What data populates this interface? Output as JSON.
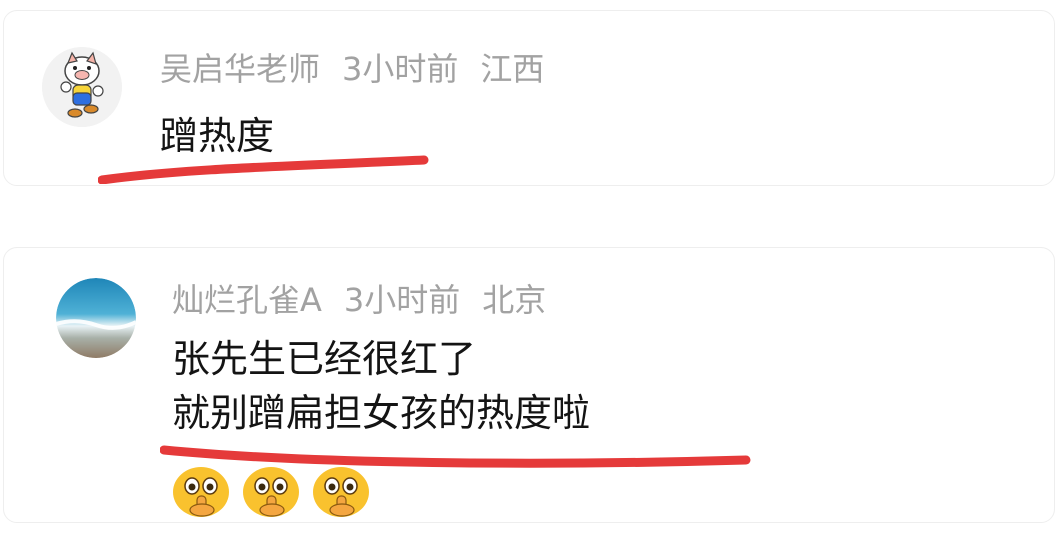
{
  "comments": [
    {
      "author": "吴启华老师",
      "time": "3小时前",
      "location": "江西",
      "lines": [
        "蹭热度"
      ],
      "underline_color": "#e53a3a"
    },
    {
      "author": "灿烂孔雀A",
      "time": "3小时前",
      "location": "北京",
      "lines": [
        "张先生已经很红了",
        "就别蹭扁担女孩的热度啦"
      ],
      "emojis": [
        "shush-emoji",
        "shush-emoji",
        "shush-emoji"
      ],
      "underline_color": "#e53a3a"
    }
  ]
}
